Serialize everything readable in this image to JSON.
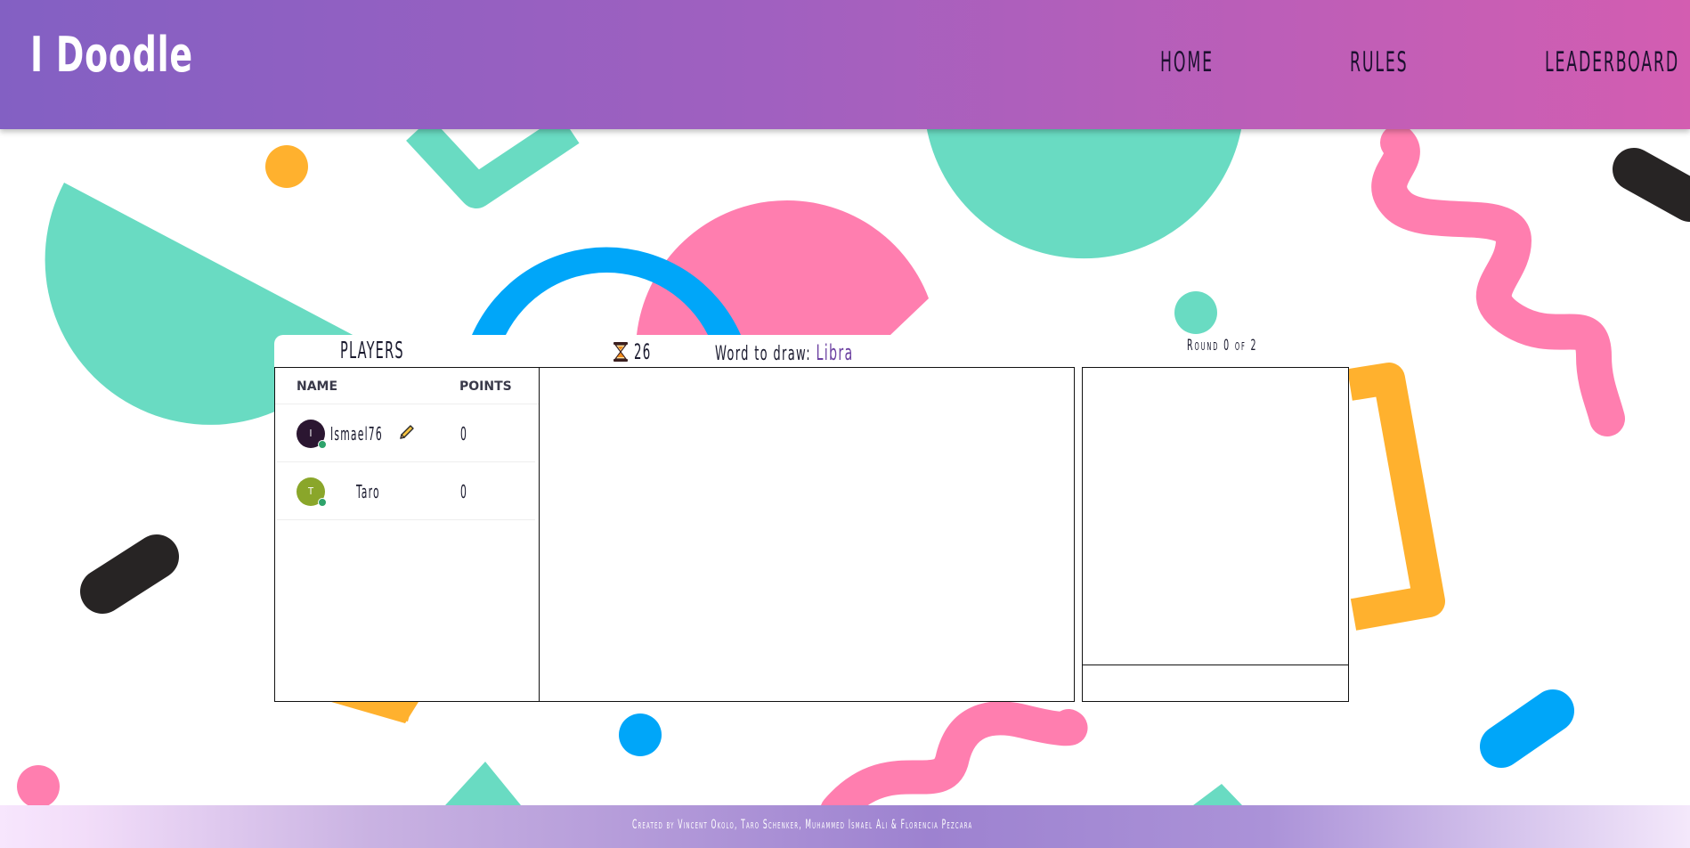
{
  "header": {
    "logo": "I Doodle",
    "nav": [
      {
        "label": "HOME"
      },
      {
        "label": "RULES"
      },
      {
        "label": "LEADERBOARD"
      }
    ]
  },
  "game": {
    "players_title": "PLAYERS",
    "timer": "26",
    "word_label": "Word to draw:",
    "word": "Libra",
    "round_label": "Round 0 of 2",
    "table": {
      "headers": [
        "NAME",
        "POINTS"
      ],
      "rows": [
        {
          "initial": "I",
          "name": "Ismael76",
          "points": "0",
          "avatar_color": "#2b1631",
          "drawing": true
        },
        {
          "initial": "T",
          "name": "Taro",
          "points": "0",
          "avatar_color": "#8aa62a",
          "drawing": false
        }
      ]
    }
  },
  "footer": {
    "credits": "Created by Vincent Okolo, Taro Schenker, Muhammed Ismael Ali & Florencia Pezcara"
  },
  "colors": {
    "header_start": "#8360c3",
    "header_end": "#d35db1",
    "teal": "#69dbc2",
    "pink": "#ff7eaf",
    "blue": "#00a6f9",
    "orange": "#ffb12e",
    "dark": "#272424"
  }
}
